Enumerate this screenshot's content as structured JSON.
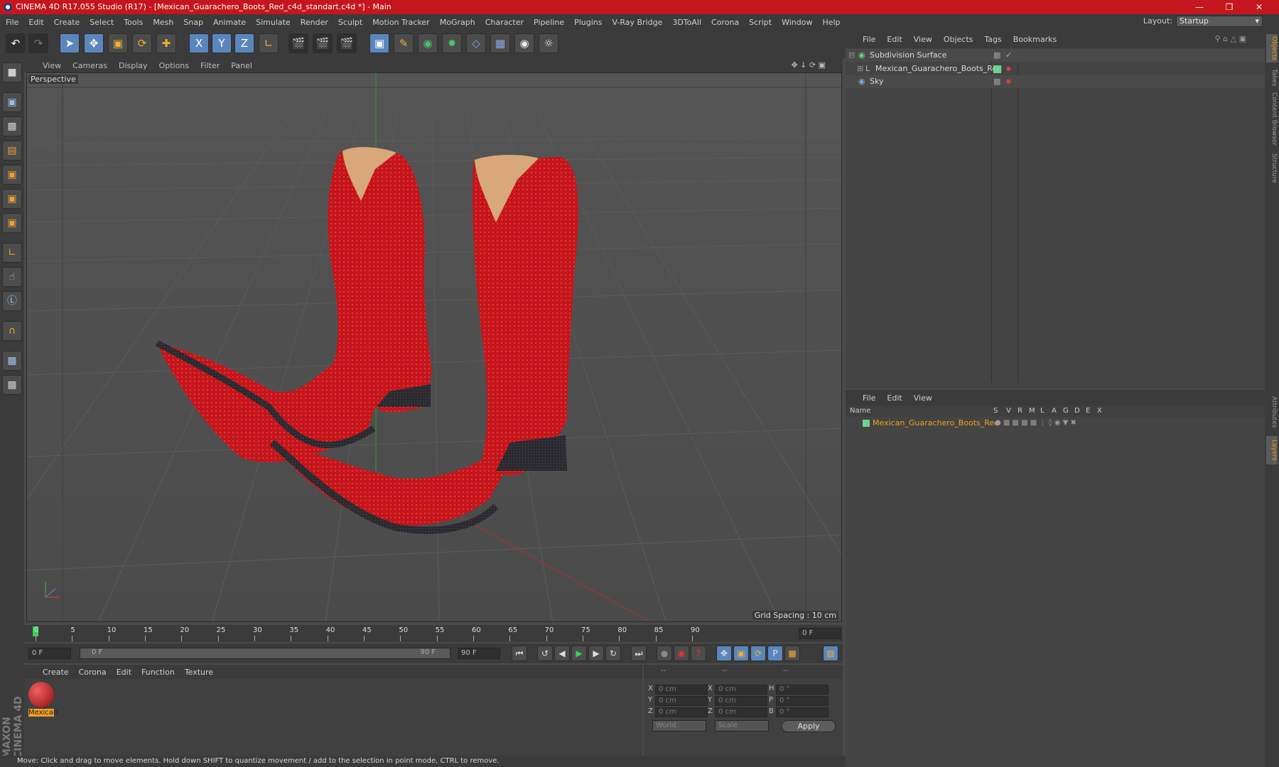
{
  "titlebar": {
    "title": "CINEMA 4D R17.055 Studio (R17) - [Mexican_Guarachero_Boots_Red_c4d_standart.c4d *] - Main"
  },
  "menubar": {
    "items": [
      "File",
      "Edit",
      "Create",
      "Select",
      "Tools",
      "Mesh",
      "Snap",
      "Animate",
      "Simulate",
      "Render",
      "Sculpt",
      "Motion Tracker",
      "MoGraph",
      "Character",
      "Pipeline",
      "Plugins",
      "V-Ray Bridge",
      "3DToAll",
      "Corona",
      "Script",
      "Window",
      "Help"
    ],
    "layout_label": "Layout:",
    "layout_value": "Startup"
  },
  "toolbar": {
    "axis_labels": [
      "X",
      "Y",
      "Z"
    ]
  },
  "viewport": {
    "menu": [
      "View",
      "Cameras",
      "Display",
      "Options",
      "Filter",
      "Panel"
    ],
    "label": "Perspective",
    "grid_spacing": "Grid Spacing : 10 cm"
  },
  "timeline": {
    "ticks": [
      "0",
      "5",
      "10",
      "15",
      "20",
      "25",
      "30",
      "35",
      "40",
      "45",
      "50",
      "55",
      "60",
      "65",
      "70",
      "75",
      "80",
      "85",
      "90"
    ],
    "current_frame": "0 F",
    "start_field": "0 F",
    "range_start": "0 F",
    "range_end": "90 F",
    "end_field": "90 F"
  },
  "materials": {
    "menu": [
      "Create",
      "Corona",
      "Edit",
      "Function",
      "Texture"
    ],
    "items": [
      {
        "label": "Mexican"
      }
    ]
  },
  "coords": {
    "headers": [
      "--",
      "--",
      "--"
    ],
    "rows": [
      {
        "a": "X",
        "av": "0 cm",
        "b": "X",
        "bv": "0 cm",
        "c": "H",
        "cv": "0 °"
      },
      {
        "a": "Y",
        "av": "0 cm",
        "b": "Y",
        "bv": "0 cm",
        "c": "P",
        "cv": "0 °"
      },
      {
        "a": "Z",
        "av": "0 cm",
        "b": "Z",
        "bv": "0 cm",
        "c": "B",
        "cv": "0 °"
      }
    ],
    "world": "World",
    "scale": "Scale",
    "apply": "Apply"
  },
  "objects": {
    "menu": [
      "File",
      "Edit",
      "View",
      "Objects",
      "Tags",
      "Bookmarks"
    ],
    "items": [
      {
        "name": "Subdivision Surface",
        "color": "#6fd08f"
      },
      {
        "name": "Mexican_Guarachero_Boots_Red",
        "color": "#6fd08f"
      },
      {
        "name": "Sky",
        "color": "#7fa8d8"
      }
    ]
  },
  "layers": {
    "menu": [
      "File",
      "Edit",
      "View"
    ],
    "columns": [
      "Name",
      "S",
      "V",
      "R",
      "M",
      "L",
      "A",
      "G",
      "D",
      "E",
      "X"
    ],
    "items": [
      {
        "name": "Mexican_Guarachero_Boots_Red",
        "color": "#6fd08f"
      }
    ]
  },
  "right_tabs": [
    "Objects",
    "Takes",
    "Content Browser",
    "Structure",
    "Attributes",
    "Layers"
  ],
  "status": "Move: Click and drag to move elements. Hold down SHIFT to quantize movement / add to the selection in point mode, CTRL to remove.",
  "brand": "MAXON CINEMA 4D"
}
